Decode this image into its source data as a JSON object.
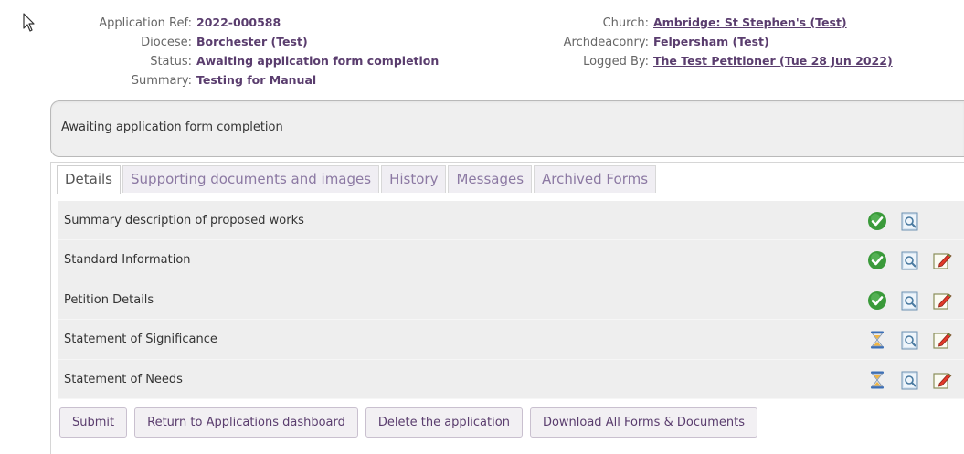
{
  "header": {
    "left": [
      {
        "label": "Application Ref:",
        "value": "2022-000588"
      },
      {
        "label": "Diocese:",
        "value": "Borchester (Test)"
      },
      {
        "label": "Status:",
        "value": "Awaiting application form completion"
      },
      {
        "label": "Summary:",
        "value": "Testing for Manual"
      }
    ],
    "right": [
      {
        "label": "Church:",
        "value": "Ambridge: St Stephen's (Test)"
      },
      {
        "label": "Archdeaconry:",
        "value": "Felpersham (Test)"
      },
      {
        "label": "Logged By:",
        "value": "The Test Petitioner (Tue 28 Jun 2022)"
      }
    ]
  },
  "status_box": "Awaiting application form completion",
  "tabs": [
    {
      "label": "Details",
      "active": true
    },
    {
      "label": "Supporting documents and images",
      "active": false
    },
    {
      "label": "History",
      "active": false
    },
    {
      "label": "Messages",
      "active": false
    },
    {
      "label": "Archived Forms",
      "active": false
    }
  ],
  "forms": [
    {
      "name": "Summary description of proposed works",
      "status": "check-icon",
      "editable": false
    },
    {
      "name": "Standard Information",
      "status": "check-icon",
      "editable": true
    },
    {
      "name": "Petition Details",
      "status": "check-icon",
      "editable": true
    },
    {
      "name": "Statement of Significance",
      "status": "hourglass-icon",
      "editable": true
    },
    {
      "name": "Statement of Needs",
      "status": "hourglass-icon",
      "editable": true
    }
  ],
  "buttons": {
    "submit": "Submit",
    "return": "Return to Applications dashboard",
    "delete": "Delete the application",
    "download": "Download All Forms & Documents"
  },
  "colors": {
    "accent": "#5a3d6e",
    "tab_text": "#8c79a3",
    "check": "#3a9a3a"
  }
}
